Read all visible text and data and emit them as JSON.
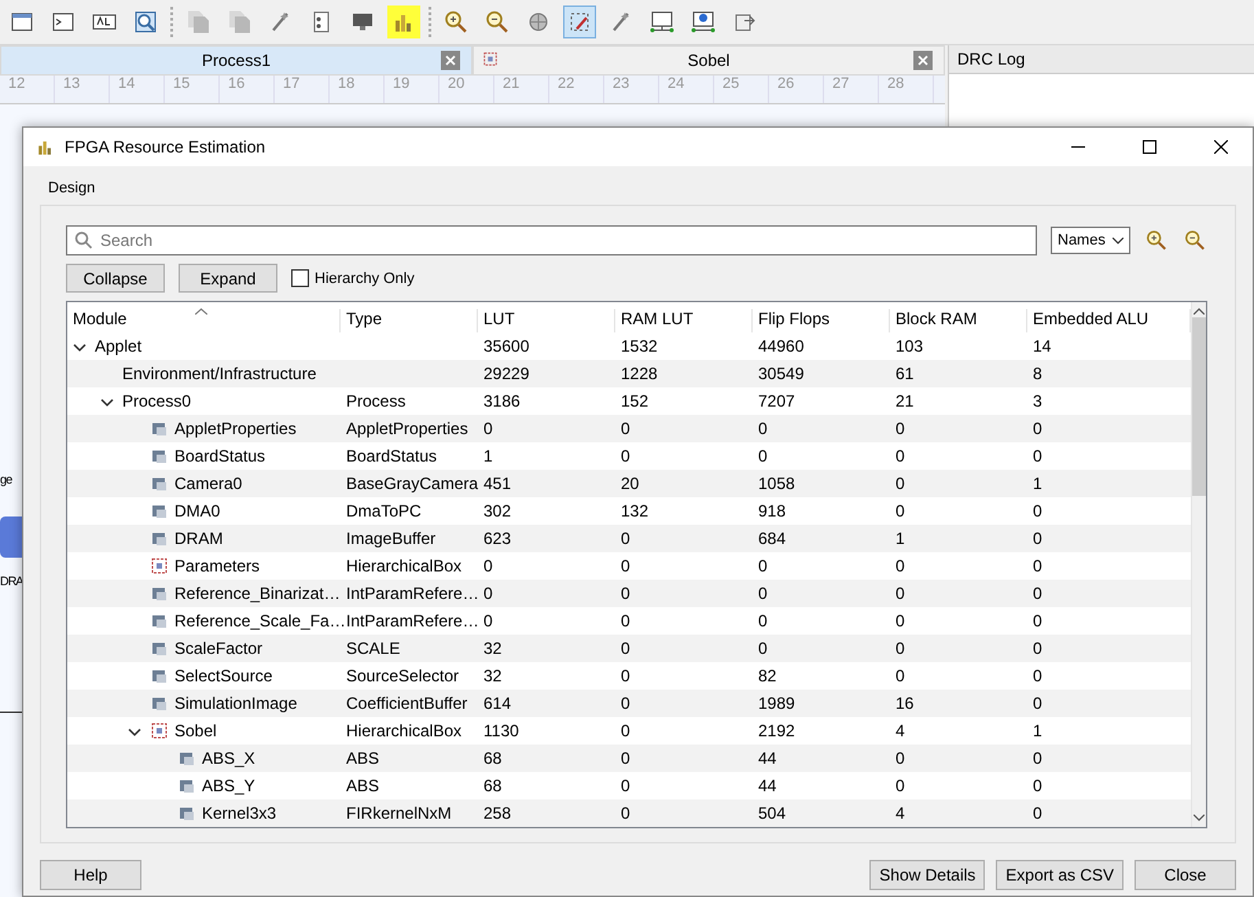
{
  "toolbar": [
    [
      {
        "kind": "window",
        "selected": false,
        "highlighted": false
      },
      {
        "kind": "terminal",
        "selected": false,
        "highlighted": false
      },
      {
        "kind": "text",
        "selected": false,
        "highlighted": false
      },
      {
        "kind": "magnifier",
        "selected": false,
        "highlighted": false
      }
    ],
    [
      {
        "kind": "checklist",
        "selected": false,
        "highlighted": false
      },
      {
        "kind": "checklist",
        "selected": false,
        "highlighted": false
      },
      {
        "kind": "wand",
        "selected": false,
        "highlighted": false
      },
      {
        "kind": "list",
        "selected": false,
        "highlighted": false
      },
      {
        "kind": "monitor",
        "selected": false,
        "highlighted": false
      },
      {
        "kind": "chart",
        "selected": false,
        "highlighted": true
      }
    ],
    [
      {
        "kind": "zoom-in",
        "selected": false,
        "highlighted": false
      },
      {
        "kind": "zoom-out",
        "selected": false,
        "highlighted": false
      },
      {
        "kind": "globe",
        "selected": false,
        "highlighted": false
      },
      {
        "kind": "select",
        "selected": true,
        "highlighted": false
      },
      {
        "kind": "wand",
        "selected": false,
        "highlighted": false
      },
      {
        "kind": "network",
        "selected": false,
        "highlighted": false
      },
      {
        "kind": "network-run",
        "selected": false,
        "highlighted": false
      },
      {
        "kind": "export",
        "selected": false,
        "highlighted": false
      }
    ]
  ],
  "tabs": [
    {
      "label": "Process1",
      "selected": true
    },
    {
      "label": "Sobel",
      "selected": false
    }
  ],
  "ruler": [
    "12",
    "13",
    "14",
    "15",
    "16",
    "17",
    "18",
    "19",
    "20",
    "21",
    "22",
    "23",
    "24",
    "25",
    "26",
    "27",
    "28"
  ],
  "canvas": {
    "fragments": [
      "ge",
      "DRA"
    ]
  },
  "drc_log": {
    "title": "DRC Log"
  },
  "dialog": {
    "title": "FPGA Resource Estimation",
    "group": "Design",
    "search": {
      "placeholder": "Search"
    },
    "view": "Names",
    "buttons": [
      "Collapse",
      "Expand"
    ],
    "hierarchy_only": {
      "label": "Hierarchy Only",
      "checked": false
    },
    "columns": [
      "Module",
      "Type",
      "LUT",
      "RAM LUT",
      "Flip Flops",
      "Block RAM",
      "Embedded ALU"
    ],
    "rows": [
      {
        "cells": [
          "Applet",
          "",
          "35600",
          "1532",
          "44960",
          "103",
          "14"
        ],
        "expanded": true,
        "children": [
          {
            "cells": [
              "Environment/Infrastructure",
              "",
              "29229",
              "1228",
              "30549",
              "61",
              "8"
            ],
            "expanded": false
          },
          {
            "cells": [
              "Process0",
              "Process",
              "3186",
              "152",
              "7207",
              "21",
              "3"
            ],
            "expanded": true,
            "children": [
              {
                "cells": [
                  "AppletProperties",
                  "AppletProperties",
                  "0",
                  "0",
                  "0",
                  "0",
                  "0"
                ],
                "kind": "module",
                "expanded": false
              },
              {
                "cells": [
                  "BoardStatus",
                  "BoardStatus",
                  "1",
                  "0",
                  "0",
                  "0",
                  "0"
                ],
                "kind": "module",
                "expanded": false
              },
              {
                "cells": [
                  "Camera0",
                  "BaseGrayCamera",
                  "451",
                  "20",
                  "1058",
                  "0",
                  "1"
                ],
                "kind": "module",
                "expanded": false
              },
              {
                "cells": [
                  "DMA0",
                  "DmaToPC",
                  "302",
                  "132",
                  "918",
                  "0",
                  "0"
                ],
                "kind": "module",
                "expanded": false
              },
              {
                "cells": [
                  "DRAM",
                  "ImageBuffer",
                  "623",
                  "0",
                  "684",
                  "1",
                  "0"
                ],
                "kind": "module",
                "expanded": false
              },
              {
                "cells": [
                  "Parameters",
                  "HierarchicalBox",
                  "0",
                  "0",
                  "0",
                  "0",
                  "0"
                ],
                "kind": "box",
                "expanded": false
              },
              {
                "cells": [
                  "Reference_Binarizat…",
                  "IntParamRefere…",
                  "0",
                  "0",
                  "0",
                  "0",
                  "0"
                ],
                "kind": "module",
                "expanded": false
              },
              {
                "cells": [
                  "Reference_Scale_Fa…",
                  "IntParamRefere…",
                  "0",
                  "0",
                  "0",
                  "0",
                  "0"
                ],
                "kind": "module",
                "expanded": false
              },
              {
                "cells": [
                  "ScaleFactor",
                  "SCALE",
                  "32",
                  "0",
                  "0",
                  "0",
                  "0"
                ],
                "kind": "module",
                "expanded": false
              },
              {
                "cells": [
                  "SelectSource",
                  "SourceSelector",
                  "32",
                  "0",
                  "82",
                  "0",
                  "0"
                ],
                "kind": "module",
                "expanded": false
              },
              {
                "cells": [
                  "SimulationImage",
                  "CoefficientBuffer",
                  "614",
                  "0",
                  "1989",
                  "16",
                  "0"
                ],
                "kind": "module",
                "expanded": false
              },
              {
                "cells": [
                  "Sobel",
                  "HierarchicalBox",
                  "1130",
                  "0",
                  "2192",
                  "4",
                  "1"
                ],
                "kind": "box",
                "expanded": true,
                "children": [
                  {
                    "cells": [
                      "ABS_X",
                      "ABS",
                      "68",
                      "0",
                      "44",
                      "0",
                      "0"
                    ],
                    "kind": "module",
                    "expanded": false
                  },
                  {
                    "cells": [
                      "ABS_Y",
                      "ABS",
                      "68",
                      "0",
                      "44",
                      "0",
                      "0"
                    ],
                    "kind": "module",
                    "expanded": false
                  },
                  {
                    "cells": [
                      "Kernel3x3",
                      "FIRkernelNxM",
                      "258",
                      "0",
                      "504",
                      "4",
                      "0"
                    ],
                    "kind": "module",
                    "expanded": false
                  }
                ]
              }
            ]
          }
        ]
      }
    ],
    "footer_left": [
      "Help"
    ],
    "footer_right": [
      "Show Details",
      "Export as CSV",
      "Close"
    ]
  }
}
